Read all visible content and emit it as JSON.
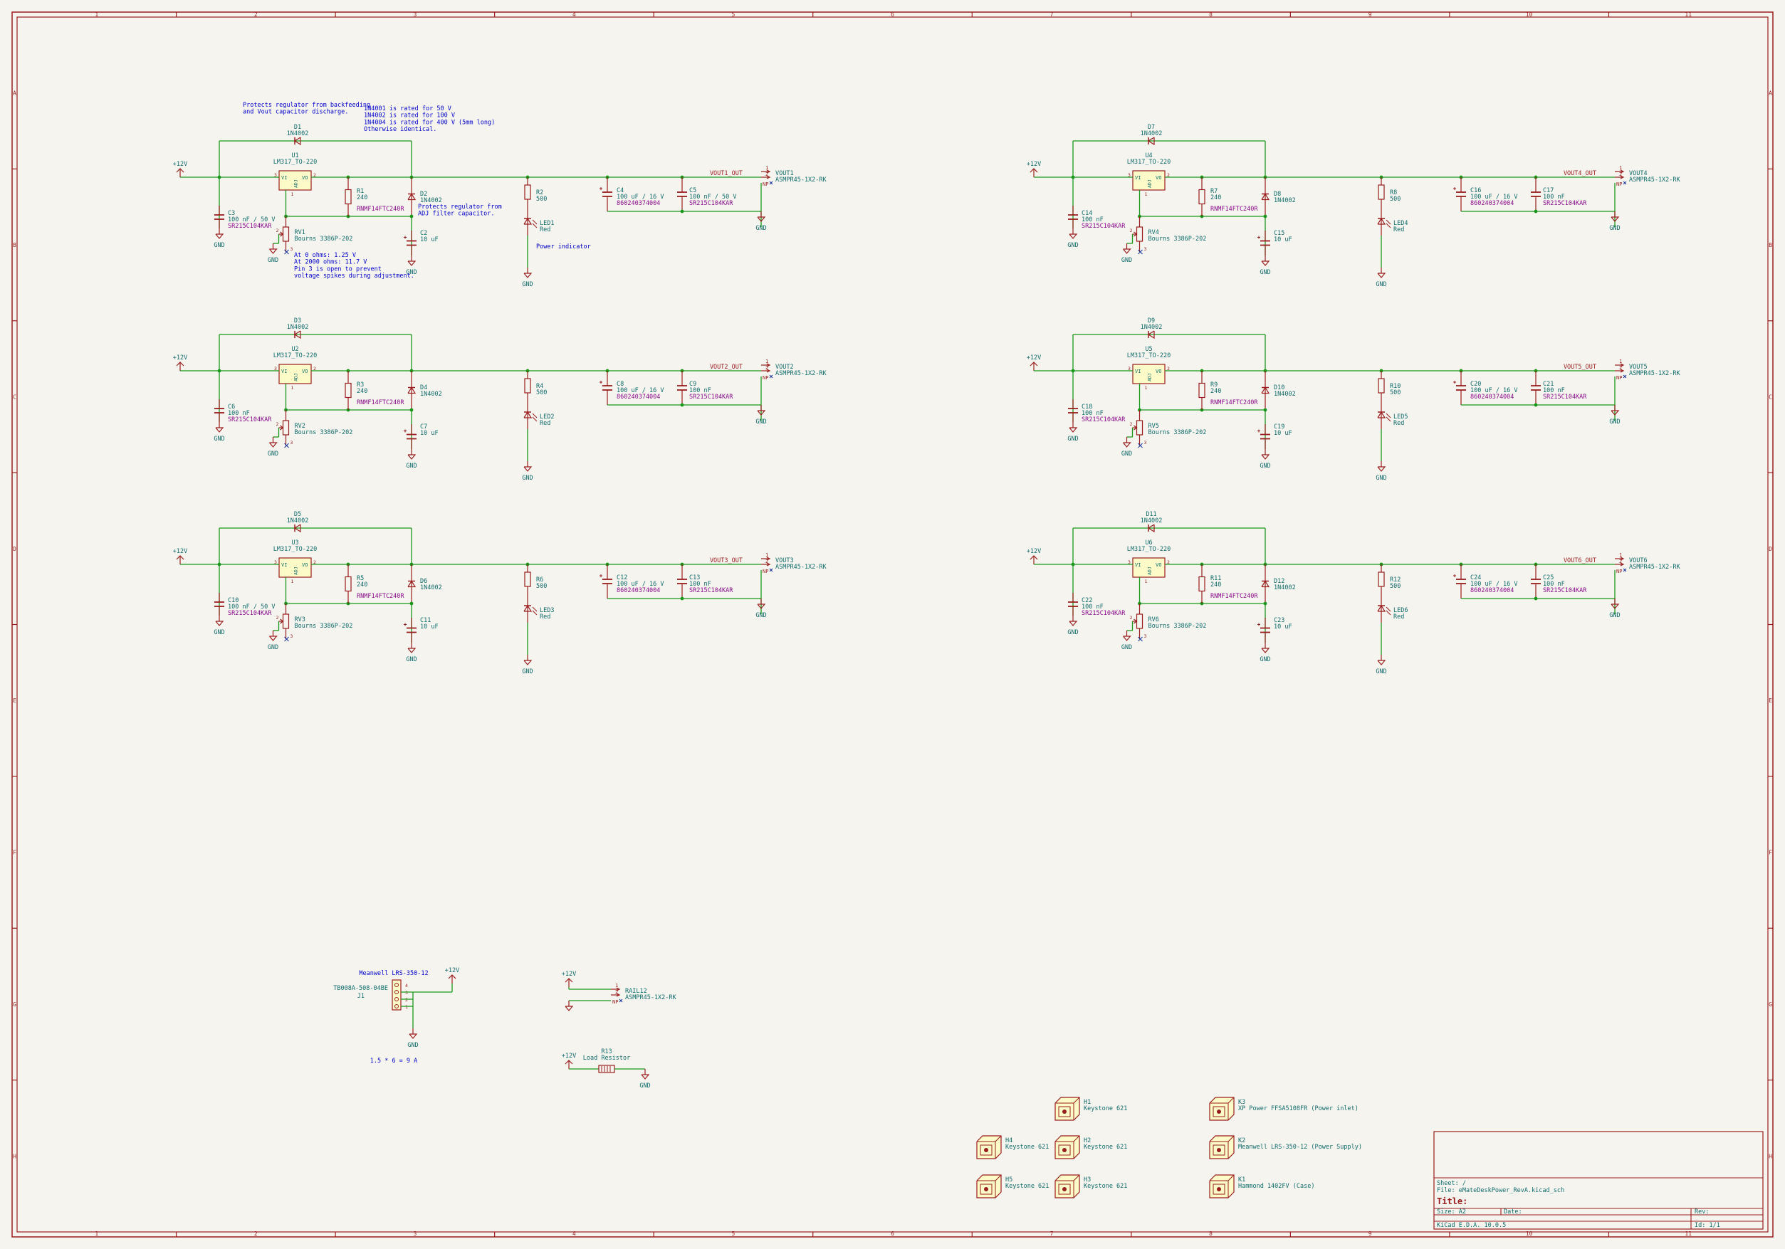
{
  "frame": {
    "cols": [
      "1",
      "2",
      "3",
      "4",
      "5",
      "6",
      "7",
      "8",
      "9",
      "10",
      "11"
    ],
    "rows": [
      "A",
      "B",
      "C",
      "D",
      "E",
      "F",
      "G",
      "H"
    ]
  },
  "colors": {
    "frame": "#9a1d1d",
    "wire": "#189818",
    "part": "#9a1d1d",
    "ref": "#0f6b6b",
    "fp": "#8a0a8a",
    "note": "#0000cc",
    "body": "#fdfbc8"
  },
  "blocks": [
    {
      "left": {
        "u": "U1",
        "d_top": "D1",
        "r": "R1",
        "rv": "RV1",
        "d_side": "D2",
        "c_in": "C3",
        "c_adj": "C2",
        "r_led": "R2",
        "led": "LED1",
        "c_bulk": "C4",
        "c_out": "C5",
        "jack": "VOUT1",
        "net": "VOUT1_OUT",
        "c_in_val": "100 nF / 50 V",
        "c_bulk_val": "100 uF / 16 V",
        "c_out_val": "100 nF / 50 V",
        "led_val": "Red",
        "led_note": "Power indicator"
      },
      "right": {
        "u": "U4",
        "d_top": "D7",
        "r": "R7",
        "rv": "RV4",
        "d_side": "D8",
        "c_in": "C14",
        "c_adj": "C15",
        "r_led": "R8",
        "led": "LED4",
        "c_bulk": "C16",
        "c_out": "C17",
        "jack": "VOUT4",
        "net": "VOUT4_OUT",
        "c_in_val": "100 nF",
        "c_bulk_val": "100 uF / 16 V",
        "c_out_val": "100 nF",
        "led_val": "Red",
        "led_note": ""
      }
    },
    {
      "left": {
        "u": "U2",
        "d_top": "D3",
        "r": "R3",
        "rv": "RV2",
        "d_side": "D4",
        "c_in": "C6",
        "c_adj": "C7",
        "r_led": "R4",
        "led": "LED2",
        "c_bulk": "C8",
        "c_out": "C9",
        "jack": "VOUT2",
        "net": "VOUT2_OUT",
        "c_in_val": "100 nF",
        "c_bulk_val": "100 uF / 16 V",
        "c_out_val": "100 nF",
        "led_val": "Red",
        "led_note": ""
      },
      "right": {
        "u": "U5",
        "d_top": "D9",
        "r": "R9",
        "rv": "RV5",
        "d_side": "D10",
        "c_in": "C18",
        "c_adj": "C19",
        "r_led": "R10",
        "led": "LED5",
        "c_bulk": "C20",
        "c_out": "C21",
        "jack": "VOUT5",
        "net": "VOUT5_OUT",
        "c_in_val": "100 nF",
        "c_bulk_val": "100 uF / 16 V",
        "c_out_val": "100 nF",
        "led_val": "Red",
        "led_note": ""
      }
    },
    {
      "left": {
        "u": "U3",
        "d_top": "D5",
        "r": "R5",
        "rv": "RV3",
        "d_side": "D6",
        "c_in": "C10",
        "c_adj": "C11",
        "r_led": "R6",
        "led": "LED3",
        "c_bulk": "C12",
        "c_out": "C13",
        "jack": "VOUT3",
        "net": "VOUT3_OUT",
        "c_in_val": "100 nF / 50 V",
        "c_bulk_val": "100 uF / 16 V",
        "c_out_val": "100 nF",
        "led_val": "Red",
        "led_note": ""
      },
      "right": {
        "u": "U6",
        "d_top": "D11",
        "r": "R11",
        "rv": "RV6",
        "d_side": "D12",
        "c_in": "C22",
        "c_adj": "C23",
        "r_led": "R12",
        "led": "LED6",
        "c_bulk": "C24",
        "c_out": "C25",
        "jack": "VOUT6",
        "net": "VOUT6_OUT",
        "c_in_val": "100 nF",
        "c_bulk_val": "100 uF / 16 V",
        "c_out_val": "100 nF",
        "led_val": "Red",
        "led_note": ""
      }
    }
  ],
  "common": {
    "plus12": "+12V",
    "gnd": "GND",
    "reg_val": "LM317_TO-220",
    "diode_val": "1N4002",
    "r_val": "240",
    "r_fp": "RNMF14FTC240R",
    "rv_val": "Bourns 3386P-202",
    "c_adj_val": "10 uF",
    "r_led_val": "500",
    "c_bulk_fp": "860240374004",
    "c_fp": "SR215C104KAR",
    "jack_val": "ASMPR45-1X2-RK",
    "pin_vi": "VI",
    "pin_vo": "VO",
    "pin_adj": "ADJ",
    "np": "NP",
    "pin1": "1",
    "pin2": "2",
    "pin3": "3"
  },
  "notes": {
    "backfeed": "Protects regulator from backfeeding\nand Vout capacitor discharge.",
    "ratings": "1N4001 is rated for 50 V\n1N4002 is rated for 100 V\n1N4004 is rated for 400 V (5mm long)\nOtherwise identical.",
    "adj_protect": "Protects regulator from\nADJ filter capacitor.",
    "range": "At 0 ohms:      1.25 V\nAt 2000 ohms: 11.7 V\nPin 3 is open to prevent\nvoltage spikes during adjustment."
  },
  "input": {
    "title": "Meanwell LRS-350-12",
    "j": "J1",
    "j_val": "TB008A-508-04BE",
    "plus12": "+12V",
    "gnd": "GND",
    "formula": "1.5 * 6 = 9 A",
    "pins": [
      "4",
      "3",
      "2",
      "1"
    ]
  },
  "rail": {
    "plus12": "+12V",
    "ref": "RAIL12",
    "val": "ASMPR45-1X2-RK",
    "np": "NP"
  },
  "load": {
    "plus12": "+12V",
    "ref": "R13",
    "val": "Load Resistor",
    "gnd": "GND"
  },
  "hardware": [
    {
      "ref": "H1",
      "val": "Keystone 621"
    },
    {
      "ref": "H2",
      "val": "Keystone 621"
    },
    {
      "ref": "H3",
      "val": "Keystone 621"
    },
    {
      "ref": "H4",
      "val": "Keystone 621"
    },
    {
      "ref": "H5",
      "val": "Keystone 621"
    },
    {
      "ref": "K3",
      "val": "XP Power FFSA5108FR (Power inlet)"
    },
    {
      "ref": "K2",
      "val": "Meanwell LRS-350-12 (Power Supply)"
    },
    {
      "ref": "K1",
      "val": "Hammond 1402FV (Case)"
    }
  ],
  "titleblock": {
    "sheet": "Sheet: /",
    "file": "File: eMateDeskPower_RevA.kicad_sch",
    "title": "Title:",
    "size": "Size: A2",
    "date": "Date:",
    "rev": "Rev:",
    "tool": "KiCad E.D.A. 10.0.5",
    "id": "Id: 1/1"
  }
}
